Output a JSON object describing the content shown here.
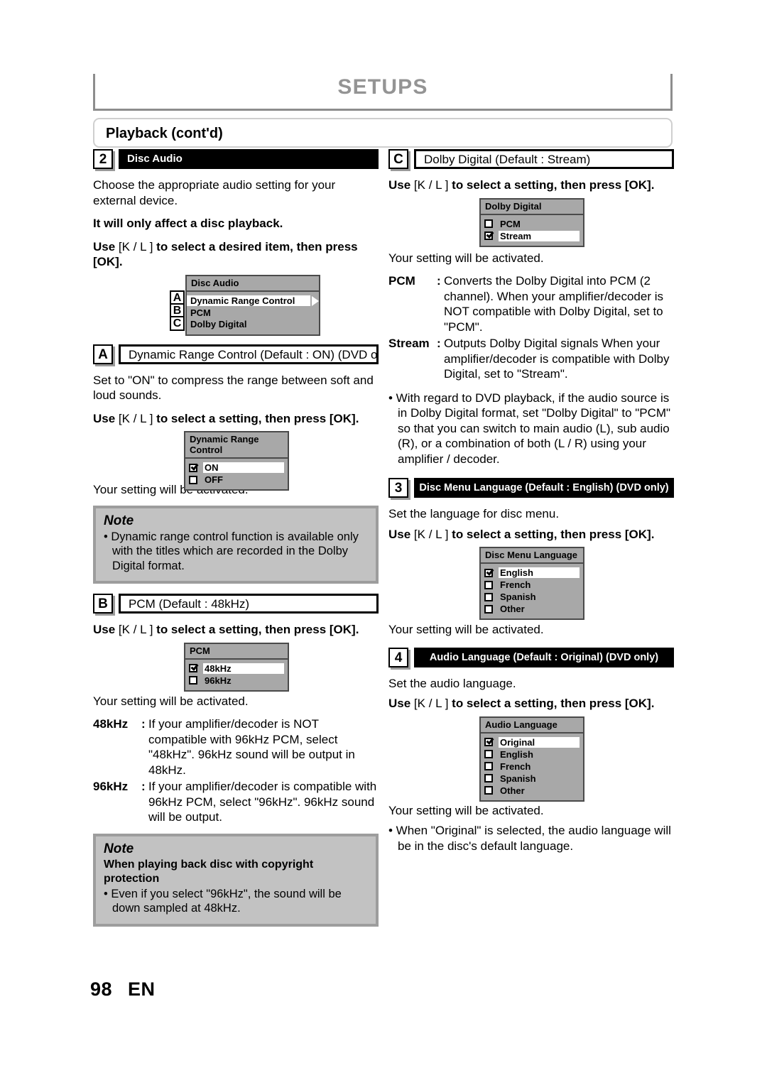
{
  "header": {
    "title": "SETUPS",
    "section_bar": "Playback (cont'd)"
  },
  "footer": {
    "page_number": "98",
    "language_code": "EN"
  },
  "left_column": {
    "section2": {
      "badge": "2",
      "title": "Disc Audio",
      "intro": "Choose the appropriate audio setting for your external device.",
      "bold_note": "It will only affect a disc playback.",
      "instruction_pre": "Use ",
      "instruction_keys": "[K / L ]",
      "instruction_post": " to select a desired item, then press [OK].",
      "menu": {
        "title": "Disc Audio",
        "items": [
          {
            "label": "Dynamic Range Control",
            "badge": "A",
            "selected": true,
            "arrow": true
          },
          {
            "label": "PCM",
            "badge": "B",
            "selected": false,
            "arrow": false
          },
          {
            "label": "Dolby Digital",
            "badge": "C",
            "selected": false,
            "arrow": false
          }
        ]
      }
    },
    "sectionA": {
      "badge": "A",
      "title": "Dynamic Range Control (Default : ON)   (DVD only)",
      "body": "Set to \"ON\" to compress the range between soft and loud sounds.",
      "instruction_pre": "Use ",
      "instruction_keys": "[K / L ]",
      "instruction_post": " to select a setting, then press [OK].",
      "menu": {
        "title": "Dynamic Range Control",
        "items": [
          {
            "label": "ON",
            "checked": true
          },
          {
            "label": "OFF",
            "checked": false
          }
        ]
      },
      "activated": "Your setting will be activated.",
      "note": {
        "heading": "Note",
        "bullet": "• Dynamic range control function is available only with the titles which are recorded in the Dolby Digital format."
      }
    },
    "sectionB": {
      "badge": "B",
      "title": "PCM (Default : 48kHz)",
      "instruction_pre": "Use ",
      "instruction_keys": "[K / L ]",
      "instruction_post": " to select a setting, then press [OK].",
      "menu": {
        "title": "PCM",
        "items": [
          {
            "label": "48kHz",
            "checked": true
          },
          {
            "label": "96kHz",
            "checked": false
          }
        ]
      },
      "activated": "Your setting will be activated.",
      "definitions": [
        {
          "term": "48kHz",
          "colon": ":",
          "desc": "If your amplifier/decoder is NOT compatible with 96kHz PCM, select \"48kHz\". 96kHz sound will be output in 48kHz."
        },
        {
          "term": "96kHz",
          "colon": ":",
          "desc": "If your amplifier/decoder is compatible with 96kHz PCM, select \"96kHz\". 96kHz sound will be output."
        }
      ],
      "note": {
        "heading": "Note",
        "subheading": "When playing back disc with copyright protection",
        "bullet": "• Even if you select \"96kHz\", the sound will be down sampled at 48kHz."
      }
    }
  },
  "right_column": {
    "sectionC": {
      "badge": "C",
      "title": "Dolby Digital (Default : Stream)",
      "instruction_pre": "Use ",
      "instruction_keys": "[K / L ]",
      "instruction_post": " to select a setting, then press [OK].",
      "menu": {
        "title": "Dolby Digital",
        "items": [
          {
            "label": "PCM",
            "checked": false
          },
          {
            "label": "Stream",
            "checked": true
          }
        ]
      },
      "activated": "Your setting will be activated.",
      "definitions": [
        {
          "term": "PCM",
          "colon": ":",
          "desc": "Converts the Dolby Digital into PCM (2 channel). When your amplifier/decoder is NOT compatible with Dolby Digital, set to \"PCM\"."
        },
        {
          "term": "Stream",
          "colon": ":",
          "desc": "Outputs Dolby Digital signals When your amplifier/decoder is compatible with Dolby Digital, set to \"Stream\"."
        }
      ],
      "bullet": "• With regard to DVD playback, if the audio source is in Dolby Digital format, set \"Dolby Digital\" to \"PCM\" so that you can switch to main audio (L), sub audio (R), or a combination of both (L / R) using your amplifier / decoder."
    },
    "section3": {
      "badge": "3",
      "title": "Disc Menu Language (Default : English) (DVD only)",
      "body": "Set the language for disc menu.",
      "instruction_pre": "Use ",
      "instruction_keys": "[K / L ]",
      "instruction_post": " to select a setting, then press [OK].",
      "menu": {
        "title": "Disc Menu Language",
        "items": [
          {
            "label": "English",
            "checked": true
          },
          {
            "label": "French",
            "checked": false
          },
          {
            "label": "Spanish",
            "checked": false
          },
          {
            "label": "Other",
            "checked": false
          }
        ]
      },
      "activated": "Your setting will be activated."
    },
    "section4": {
      "badge": "4",
      "title": "Audio Language (Default : Original)  (DVD only)",
      "body": "Set the audio language.",
      "instruction_pre": "Use ",
      "instruction_keys": "[K / L ]",
      "instruction_post": " to select a setting, then press [OK].",
      "menu": {
        "title": "Audio Language",
        "items": [
          {
            "label": "Original",
            "checked": true
          },
          {
            "label": "English",
            "checked": false
          },
          {
            "label": "French",
            "checked": false
          },
          {
            "label": "Spanish",
            "checked": false
          },
          {
            "label": "Other",
            "checked": false
          }
        ]
      },
      "activated": "Your setting will be activated.",
      "bullet": "• When \"Original\" is selected, the audio language will be in the disc's default language."
    }
  },
  "colors": {
    "header_gray": "#949494",
    "menu_gray": "#a8a8a8",
    "note_gray": "#c2c2c2",
    "note_border": "#9d9d9d",
    "black": "#000000"
  }
}
